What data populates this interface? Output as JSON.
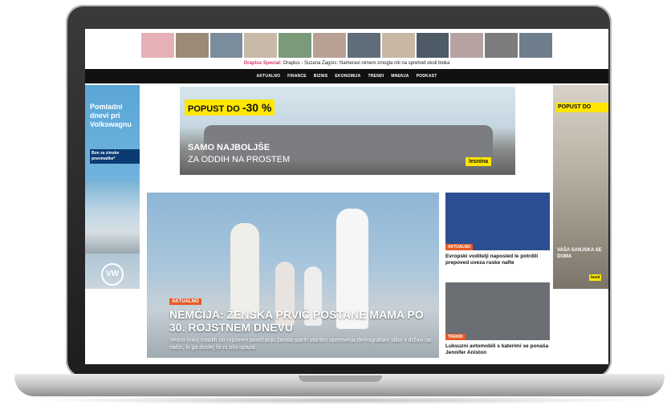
{
  "header": {
    "thumb_colors": [
      "#e6b1b6",
      "#9c8a79",
      "#7b8c9c",
      "#c9b9a9",
      "#7a9a7a",
      "#b9a095",
      "#5f6d7a",
      "#c8b7a3",
      "#4d5b67",
      "#b7a2a2",
      "#7c7c7c",
      "#6f7e8c"
    ],
    "ticker_tag": "Oraplus Special:",
    "ticker_text": "Oraplus - Suzana Zagorc: Nameravi nimem zmogla niti na sprehod okoli bloka"
  },
  "nav": {
    "items": [
      "AKTUALNO",
      "FINANCE",
      "BIZNIS",
      "EKONOMIJA",
      "TRENDI",
      "MNENJA",
      "PODKAST"
    ]
  },
  "left_ad": {
    "headline": "Pomladni dnevi pri Volkswagnu",
    "subline": "Bon za zimske pnevmatike*",
    "logo": "VW"
  },
  "banner_ad": {
    "badge_prefix": "POPUST DO",
    "badge_value": "-30 %",
    "headline1": "SAMO NAJBOLJŠE",
    "headline2": "ZA ODDIH NA PROSTEM",
    "brand": "lesnina"
  },
  "right_ad": {
    "badge": "POPUST DO",
    "text": "VAŠA SANJSKA SE DOMA",
    "brand": "lesni"
  },
  "main_article": {
    "label": "AKTUALNO",
    "title": "NEMČIJA: ŽENSKA PRVIČ POSTANE MAMA PO 30. ROJSTNEM DNEVU",
    "description": "Vedno manj mladih ob rojstnem povečanju števila starih staršev spremenja demografsko sliko v državi na način, ki ga doslej še ni bilo opaziti."
  },
  "side_articles": [
    {
      "label": "AKTUALNO",
      "title": "Evropski voditelji naposled le potrdili prepoved uveza ruske nafte",
      "image_color": "#2b4f92"
    },
    {
      "label": "TRENDI",
      "title": "Luksuzni avtomobili s katerimi se ponaša Jennifer Aniston",
      "image_color": "#6b6e72"
    }
  ]
}
